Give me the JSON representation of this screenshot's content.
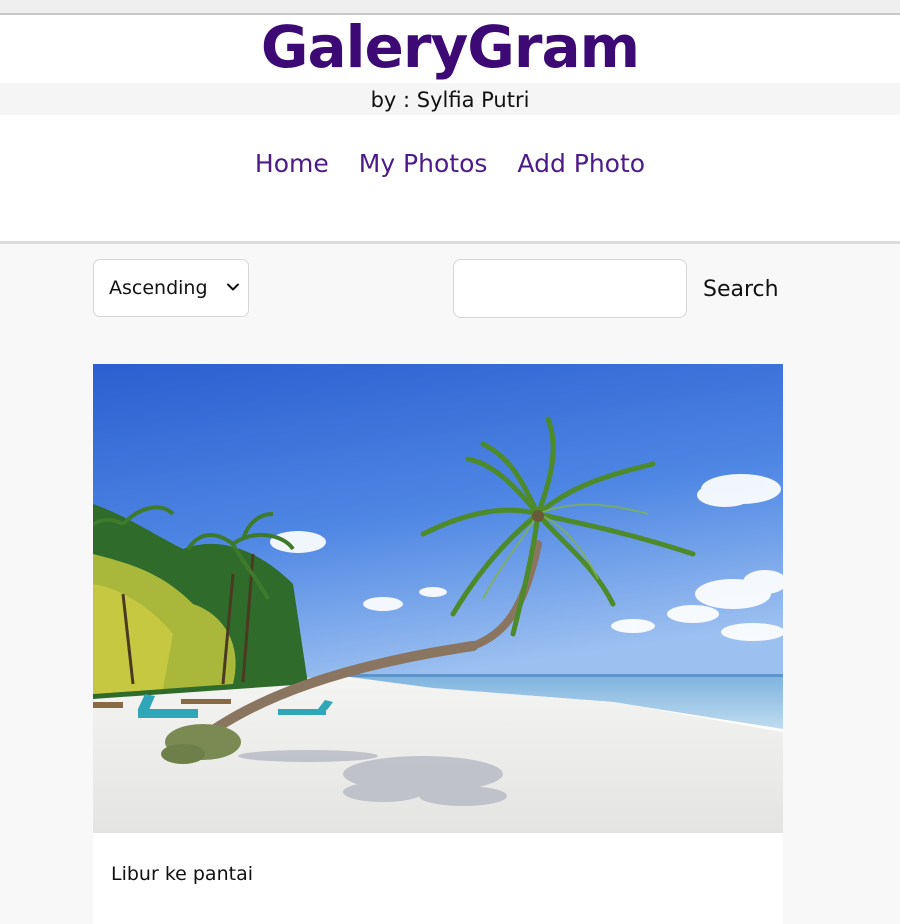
{
  "app": {
    "title": "GaleryGram",
    "byline": "by : Sylfia Putri"
  },
  "nav": {
    "items": [
      {
        "label": "Home"
      },
      {
        "label": "My Photos"
      },
      {
        "label": "Add Photo"
      }
    ]
  },
  "controls": {
    "sort_selected": "Ascending",
    "search_value": "",
    "search_placeholder": "",
    "search_button": "Search"
  },
  "gallery": {
    "items": [
      {
        "caption": "Libur ke pantai",
        "image": "beach-palm-tree-photo"
      }
    ]
  },
  "colors": {
    "brand": "#3d0a75",
    "nav_link": "#4d1a8a",
    "page_bg": "#f8f8f8"
  }
}
